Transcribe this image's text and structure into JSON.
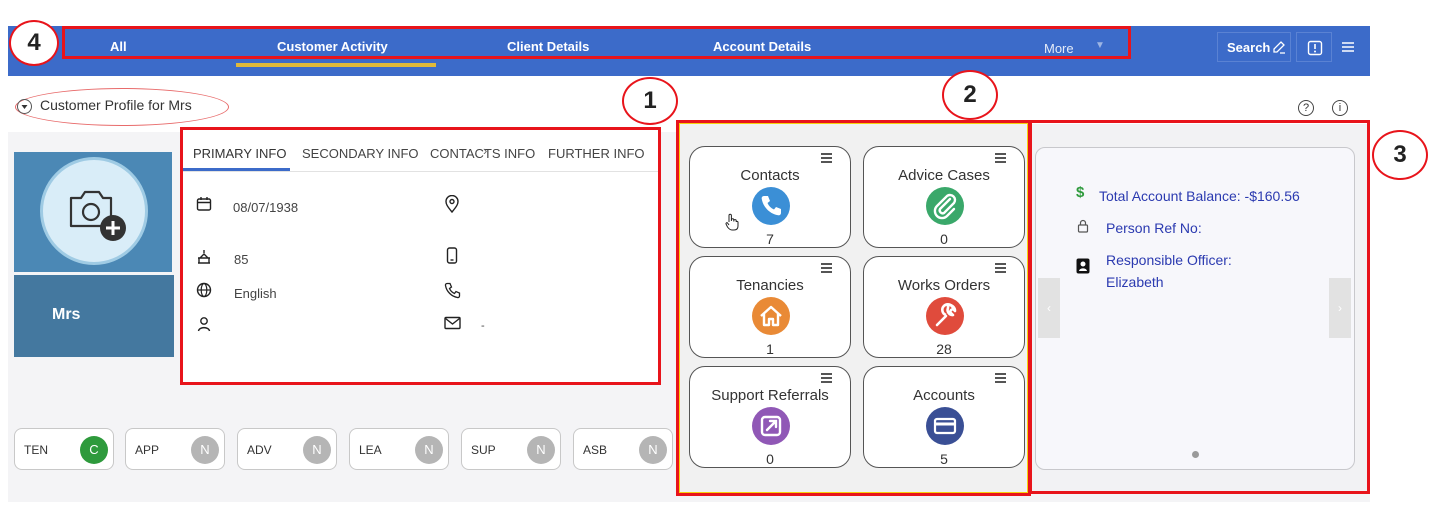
{
  "nav": {
    "tabs": [
      "All",
      "Customer Activity",
      "Client Details",
      "Account Details"
    ],
    "more_label": "More",
    "search_label": "Search"
  },
  "profile": {
    "title": "Customer Profile for Mrs",
    "name": "Mrs"
  },
  "info_tabs": [
    "PRIMARY INFO",
    "SECONDARY INFO",
    "CONTACTS INFO",
    "FURTHER INFO"
  ],
  "primary_info": {
    "dob": "08/07/1938",
    "age": "85",
    "language": "English",
    "email": "-"
  },
  "chips": [
    {
      "label": "TEN",
      "badge": "C",
      "color": "#2e9a3c"
    },
    {
      "label": "APP",
      "badge": "N",
      "color": "#b5b5b5"
    },
    {
      "label": "ADV",
      "badge": "N",
      "color": "#b5b5b5"
    },
    {
      "label": "LEA",
      "badge": "N",
      "color": "#b5b5b5"
    },
    {
      "label": "SUP",
      "badge": "N",
      "color": "#b5b5b5"
    },
    {
      "label": "ASB",
      "badge": "N",
      "color": "#b5b5b5"
    }
  ],
  "tiles": [
    {
      "title": "Contacts",
      "count": "7",
      "icon": "phone-icon",
      "color": "#3b8fd6"
    },
    {
      "title": "Advice Cases",
      "count": "0",
      "icon": "paperclip-icon",
      "color": "#3aa86a"
    },
    {
      "title": "Tenancies",
      "count": "1",
      "icon": "home-icon",
      "color": "#e98a36"
    },
    {
      "title": "Works Orders",
      "count": "28",
      "icon": "wrench-icon",
      "color": "#e04b3c"
    },
    {
      "title": "Support Referrals",
      "count": "0",
      "icon": "external-link-icon",
      "color": "#9058b6"
    },
    {
      "title": "Accounts",
      "count": "5",
      "icon": "credit-card-icon",
      "color": "#3a4f95"
    }
  ],
  "account": {
    "balance": "Total Account Balance: -$160.56",
    "person_ref": "Person Ref No:",
    "officer_label": "Responsible Officer:",
    "officer_name": "Elizabeth"
  },
  "annotations": [
    "1",
    "2",
    "3",
    "4"
  ],
  "colors": {
    "nav": "#3c6bc9",
    "annotation": "#e8141b",
    "accent": "#e0b93a"
  }
}
